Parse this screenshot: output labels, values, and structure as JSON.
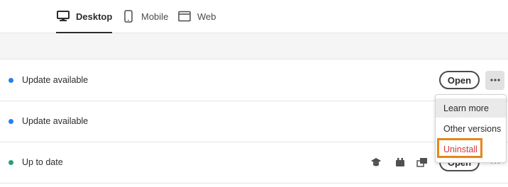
{
  "tabs": [
    {
      "label": "Desktop",
      "icon": "desktop-icon",
      "active": true
    },
    {
      "label": "Mobile",
      "icon": "mobile-icon",
      "active": false
    },
    {
      "label": "Web",
      "icon": "web-icon",
      "active": false
    }
  ],
  "rows": [
    {
      "status": "Update available",
      "status_color": "#2680eb",
      "open_label": "Open"
    },
    {
      "status": "Update available",
      "status_color": "#2680eb"
    },
    {
      "status": "Up to date",
      "status_color": "#2d9d78",
      "open_label": "Open"
    }
  ],
  "menu": {
    "items": [
      {
        "label": "Learn more"
      },
      {
        "label": "Other versions"
      },
      {
        "label": "Uninstall"
      }
    ]
  },
  "row_icons": [
    "learn-icon",
    "plugins-icon",
    "share-icon"
  ],
  "colors": {
    "accent_highlight": "#e68619",
    "danger": "#d7373f"
  }
}
